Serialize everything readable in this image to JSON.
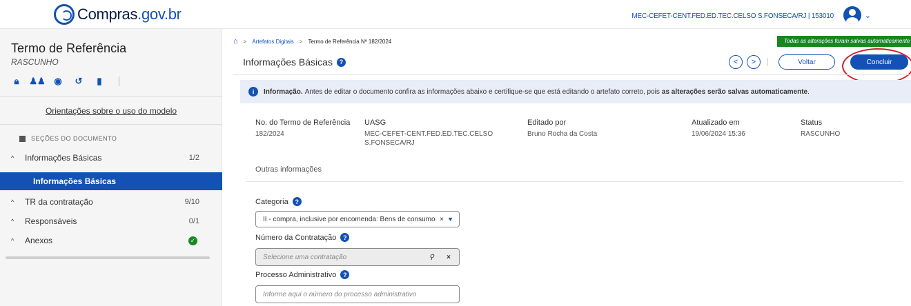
{
  "header": {
    "logo_text": "Compras",
    "logo_domain": ".gov.br",
    "uasg_user": "MEC-CEFET-CENT.FED.ED.TEC.CELSO S.FONSECA/RJ | 153010"
  },
  "sidebar": {
    "title": "Termo de Referência",
    "status": "RASCUNHO",
    "guide_link": "Orientações sobre o uso do modelo",
    "sections_heading": "SEÇÕES DO DOCUMENTO",
    "items": [
      {
        "label": "Informações Básicas",
        "count": "1/2"
      },
      {
        "label": "Informações Básicas"
      },
      {
        "label": "TR da contratação",
        "count": "9/10"
      },
      {
        "label": "Responsáveis",
        "count": "0/1"
      },
      {
        "label": "Anexos"
      }
    ]
  },
  "breadcrumb": {
    "items": [
      "Artefatos Digitais",
      "Termo de Referência Nº 182/2024"
    ]
  },
  "saved_notice": "Todas as alterações foram salvas automaticamente",
  "main": {
    "title": "Informações Básicas",
    "btn_voltar": "Voltar",
    "btn_concluir": "Concluir",
    "info": {
      "label": "Informação.",
      "text": "Antes de editar o documento confira as informações abaixo e certifique-se que está editando o artefato correto, pois",
      "strong": "as alterações serão salvas automaticamente",
      "end": "."
    },
    "fields": [
      {
        "label": "No. do Termo de Referência",
        "value": "182/2024"
      },
      {
        "label": "UASG",
        "value": "MEC-CEFET-CENT.FED.ED.TEC.CELSO S.FONSECA/RJ"
      },
      {
        "label": "Editado por",
        "value": "Bruno Rocha da Costa"
      },
      {
        "label": "Atualizado em",
        "value": "19/06/2024 15:36"
      },
      {
        "label": "Status",
        "value": "RASCUNHO"
      }
    ],
    "outras": "Outras informações",
    "categoria": {
      "label": "Categoria",
      "value": "II - compra, inclusive por encomenda: Bens de consumo"
    },
    "numero_contratacao": {
      "label": "Número da Contratação",
      "placeholder": "Selecione uma contratação"
    },
    "processo": {
      "label": "Processo Administrativo",
      "placeholder": "Informe aqui o número do processo administrativo"
    }
  }
}
